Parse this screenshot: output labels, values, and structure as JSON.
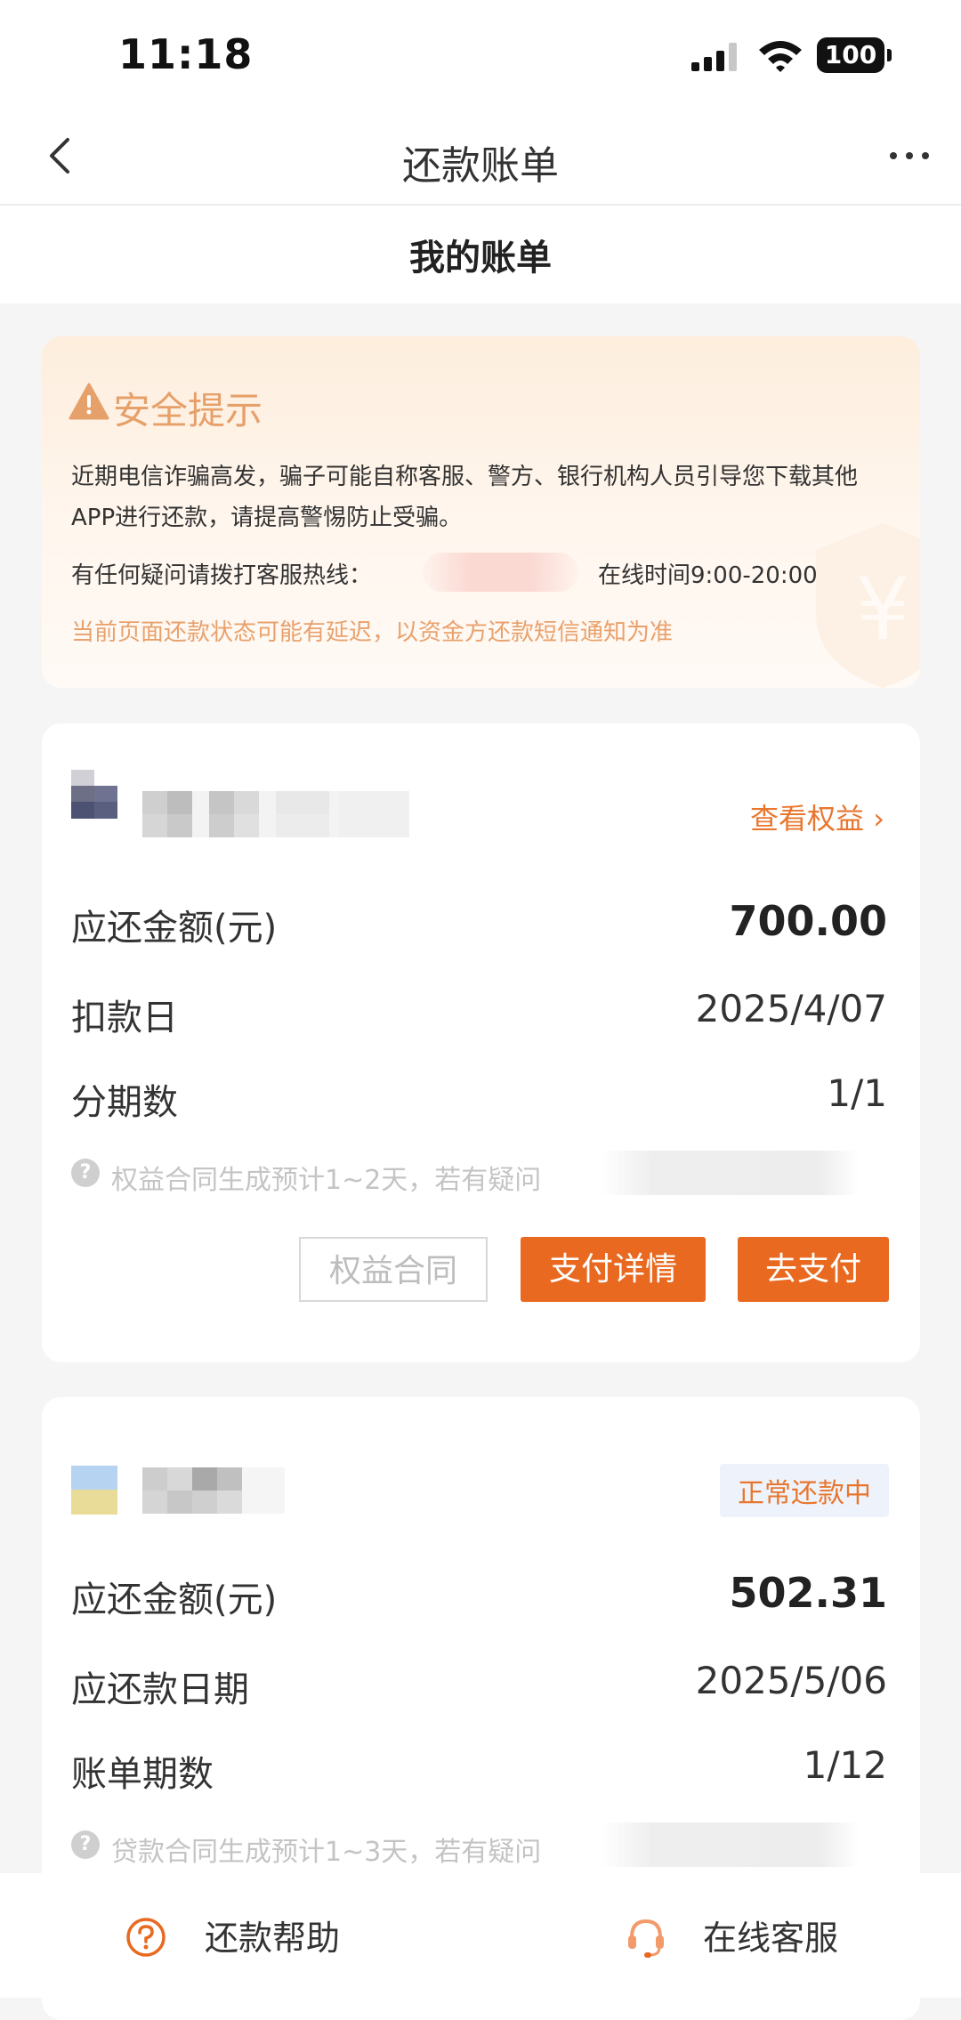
{
  "status_bar": {
    "time": "11:18",
    "battery": "100"
  },
  "nav": {
    "title": "还款账单"
  },
  "subheader": {
    "title": "我的账单"
  },
  "notice": {
    "title": "安全提示",
    "text": "近期电信诈骗高发，骗子可能自称客服、警方、银行机构人员引导您下载其他APP进行还款，请提高警惕防止受骗。",
    "hotline_label": "有任何疑问请拨打客服热线：",
    "online_hours": "在线时间9:00-20:00",
    "delay_note": "当前页面还款状态可能有延迟，以资金方还款短信通知为准",
    "watermark_symbol": "¥"
  },
  "bills": [
    {
      "link": "查看权益 ›",
      "rows": [
        {
          "label": "应还金额(元)",
          "value": "700.00"
        },
        {
          "label": "扣款日",
          "value": "2025/4/07"
        },
        {
          "label": "分期数",
          "value": "1/1"
        }
      ],
      "hint": "权益合同生成预计1~2天，若有疑问",
      "buttons": {
        "contract": "权益合同",
        "pay_detail": "支付详情",
        "pay": "去支付"
      }
    },
    {
      "status": "正常还款中",
      "rows": [
        {
          "label": "应还金额(元)",
          "value": "502.31"
        },
        {
          "label": "应还款日期",
          "value": "2025/5/06"
        },
        {
          "label": "账单期数",
          "value": "1/12"
        }
      ],
      "hint": "贷款合同生成预计1~3天，若有疑问"
    }
  ],
  "bottom_bar": {
    "help": "还款帮助",
    "service": "在线客服"
  },
  "colors": {
    "accent": "#e8691f",
    "notice_title": "#e6a06a",
    "link": "#e8762e"
  }
}
